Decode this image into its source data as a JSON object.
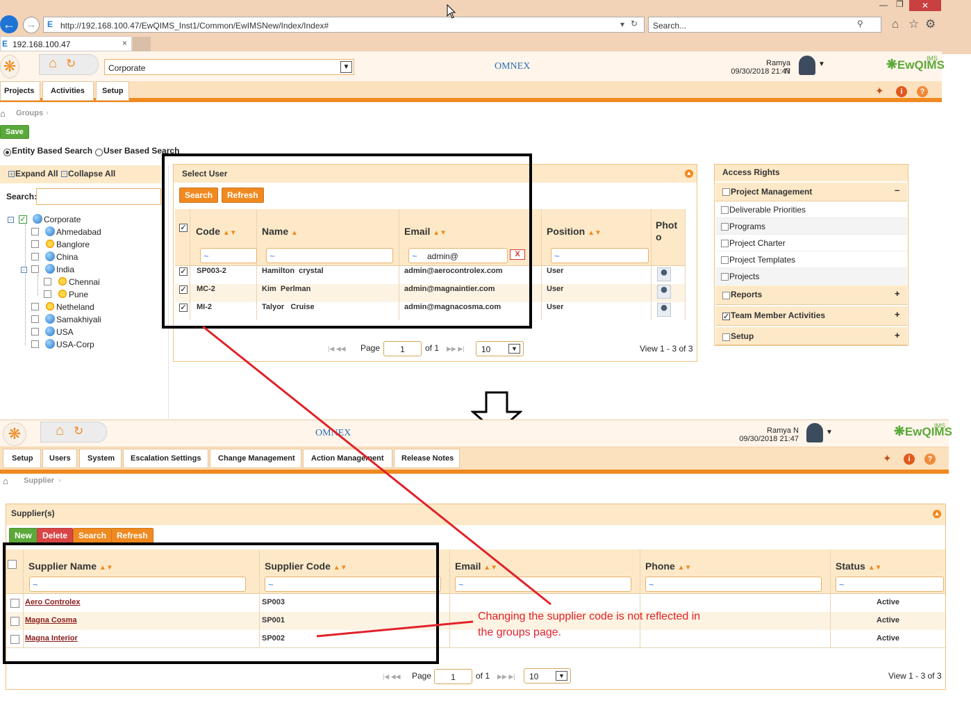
{
  "browser": {
    "url": "http://192.168.100.47/EwQIMS_Inst1/Common/EwIMSNew/Index/Index#",
    "search_placeholder": "Search...",
    "tab_title": "192.168.100.47"
  },
  "top": {
    "org_select": "Corporate",
    "user_name": "Ramya N",
    "datetime": "09/30/2018 21:47",
    "omnex": "OMNEX",
    "ewqims": "EwQIMS",
    "ims": "IMS"
  },
  "nav": {
    "items": [
      "Projects",
      "Activities",
      "Setup"
    ]
  },
  "breadcrumb1": "Groups",
  "save_label": "Save",
  "search_mode": {
    "entity": "Entity Based Search",
    "user": "User Based Search"
  },
  "tree": {
    "expand": "Expand All",
    "collapse": "Collapse All",
    "search_label": "Search:",
    "nodes": [
      "Corporate",
      "Ahmedabad",
      "Banglore",
      "China",
      "India",
      "Chennai",
      "Pune",
      "Netheland",
      "Samakhiyali",
      "USA",
      "USA-Corp"
    ]
  },
  "select_user": {
    "title": "Select User",
    "search": "Search",
    "refresh": "Refresh",
    "cols": [
      "Code",
      "Name",
      "Email",
      "Position",
      "Phot o"
    ],
    "email_filter": "admin@",
    "clear": "X",
    "rows": [
      {
        "code": "SP003-2",
        "name": "Hamilton  crystal",
        "email": "admin@aerocontrolex.com",
        "position": "User"
      },
      {
        "code": "MC-2",
        "name": "Kim  Perlman",
        "email": "admin@magnaintier.com",
        "position": "User"
      },
      {
        "code": "MI-2",
        "name": "Talyor   Cruise",
        "email": "admin@magnacosma.com",
        "position": "User"
      }
    ],
    "pager": {
      "page": "Page",
      "num": "1",
      "of": "of 1",
      "size": "10",
      "view": "View 1 - 3 of 3"
    }
  },
  "access": {
    "title": "Access Rights",
    "pm": "Project Management",
    "items": [
      "Deliverable Priorities",
      "Programs",
      "Project Charter",
      "Project Templates",
      "Projects"
    ],
    "reports": "Reports",
    "tma": "Team Member Activities",
    "setup": "Setup",
    "minus": "–",
    "plus": "+"
  },
  "top2": {
    "user_name": "Ramya N",
    "datetime": "09/30/2018 21:47"
  },
  "nav2": {
    "items": [
      "Setup",
      "Users",
      "System",
      "Escalation Settings",
      "Change Management",
      "Action Management",
      "Release Notes"
    ]
  },
  "breadcrumb2": "Supplier",
  "suppliers": {
    "title": "Supplier(s)",
    "new": "New",
    "delete": "Delete",
    "search": "Search",
    "refresh": "Refresh",
    "cols": [
      "Supplier Name",
      "Supplier Code",
      "Email",
      "Phone",
      "Status"
    ],
    "rows": [
      {
        "name": "Aero Controlex",
        "code": "SP003",
        "status": "Active"
      },
      {
        "name": "Magna Cosma",
        "code": "SP001",
        "status": "Active"
      },
      {
        "name": "Magna Interior",
        "code": "SP002",
        "status": "Active"
      }
    ],
    "pager": {
      "page": "Page",
      "num": "1",
      "of": "of 1",
      "size": "10",
      "view": "View 1 - 3 of 3"
    }
  },
  "annotation": "Changing the supplier code is not reflected in the groups page."
}
